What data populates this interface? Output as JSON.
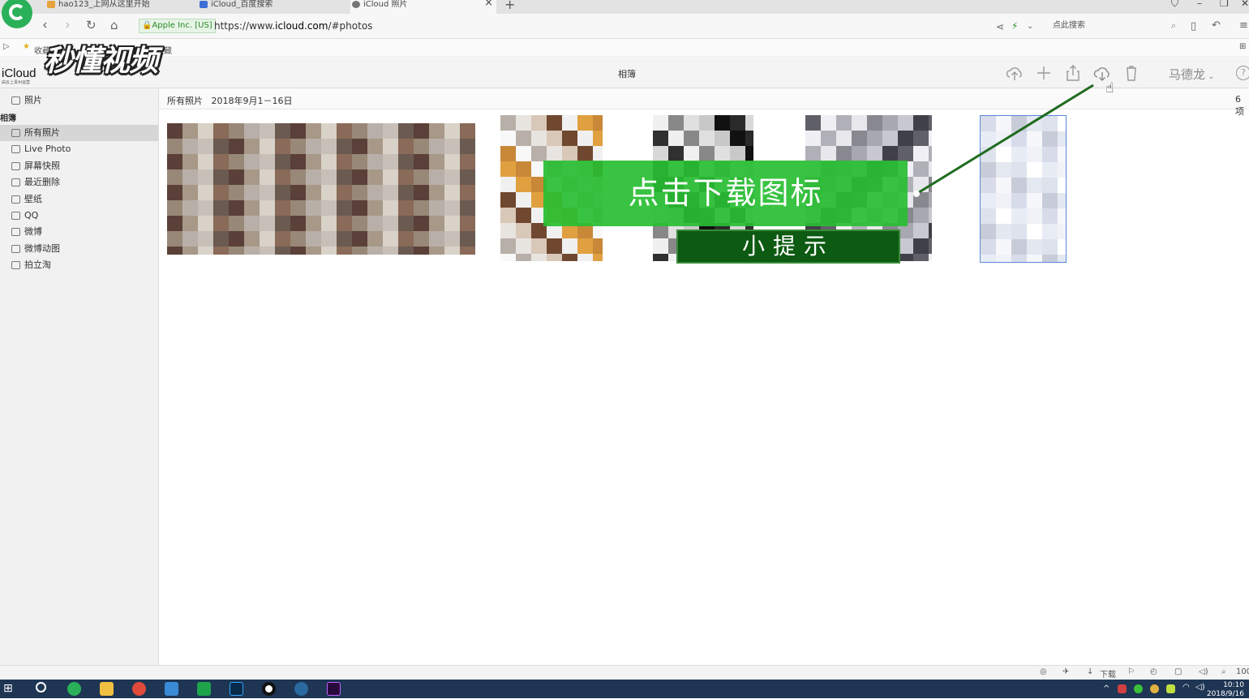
{
  "browser": {
    "tabs": [
      {
        "label": "hao123_上网从这里开始"
      },
      {
        "label": "iCloud_百度搜索"
      },
      {
        "label": "iCloud 照片"
      }
    ],
    "tab_close": "×",
    "new_tab": "+",
    "security_badge": "Apple Inc. [US]",
    "url_prefix": "https://www.",
    "url_host": "icloud.com",
    "url_path": "/#photos",
    "search_placeholder": "点此搜索",
    "bookmarks": [
      "收藏",
      "您还没有收藏"
    ]
  },
  "watermark": {
    "text": "秒懂视频"
  },
  "app": {
    "brand": "iCloud",
    "brand_sub": "由云上贵州运营",
    "toolbar_title": "相簿",
    "user_name": "马德龙",
    "help": "?"
  },
  "sidebar": {
    "top_item": "照片",
    "section_header": "相簿",
    "items": [
      {
        "label": "所有照片",
        "icon": "album-icon"
      },
      {
        "label": "Live Photo",
        "icon": "live-photo-icon"
      },
      {
        "label": "屏幕快照",
        "icon": "screenshot-icon"
      },
      {
        "label": "最近删除",
        "icon": "trash-icon"
      },
      {
        "label": "壁纸",
        "icon": "album-icon"
      },
      {
        "label": "QQ",
        "icon": "qq-album-icon"
      },
      {
        "label": "微博",
        "icon": "album-icon"
      },
      {
        "label": "微博动图",
        "icon": "album-icon"
      },
      {
        "label": "拍立淘",
        "icon": "album-icon"
      }
    ]
  },
  "main": {
    "title_album": "所有照片",
    "title_range": "2018年9月1－16日",
    "count": "6 项"
  },
  "tip": {
    "main_text": "点击下载图标",
    "sub_text": "小提示",
    "colors": {
      "main_bg": "#28be32",
      "sub_bg": "#0d5a12",
      "pointer": "#1f6b1f"
    }
  },
  "statusbar": {
    "download": "下载",
    "zoom": "100"
  },
  "taskbar": {
    "time": "10:10",
    "date": "2018/9/16"
  }
}
